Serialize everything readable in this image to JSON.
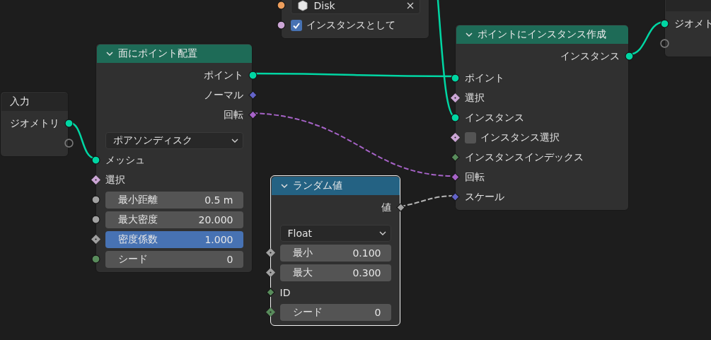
{
  "nodes": [
    {
      "title": "入力",
      "color": "#262626",
      "selected": false,
      "rows": [
        {
          "kind": "output",
          "label": "ジオメトリ",
          "socket": {
            "kind": "circle",
            "color": "#00d6a3"
          }
        },
        {
          "kind": "output",
          "socket": {
            "kind": "hollow"
          }
        }
      ]
    },
    {
      "selected": false,
      "rows": [
        {
          "kind": "object",
          "value": "Disk",
          "socket": {
            "kind": "circle",
            "color": "#ed9e5c"
          }
        },
        {
          "kind": "checkbox",
          "label": "インスタンスとして",
          "checked": true,
          "socket": {
            "kind": "circle",
            "color": "#cca6d6"
          }
        }
      ]
    },
    {
      "title": "面にポイント配置",
      "color": "#1e6b57",
      "expanded": true,
      "selected": false,
      "rows": [
        {
          "kind": "output",
          "label": "ポイント",
          "socket": {
            "kind": "circle",
            "color": "#00d6a3"
          }
        },
        {
          "kind": "output",
          "label": "ノーマル",
          "socket": {
            "kind": "diamond",
            "color": "#6363c7"
          }
        },
        {
          "kind": "output",
          "label": "回転",
          "socket": {
            "kind": "diamond",
            "color": "#a663c7"
          }
        },
        {
          "kind": "dropdown",
          "value": "ポアソンディスク"
        },
        {
          "kind": "input",
          "label": "メッシュ",
          "socket": {
            "kind": "circle",
            "color": "#00d6a3"
          }
        },
        {
          "kind": "input",
          "label": "選択",
          "socket": {
            "kind": "diamond_dot",
            "color": "#cca6d6"
          }
        },
        {
          "kind": "value",
          "label": "最小距離",
          "value": "0.5 m",
          "active": false,
          "socket": {
            "kind": "circle",
            "color": "#a1a1a1"
          }
        },
        {
          "kind": "value",
          "label": "最大密度",
          "value": "20.000",
          "active": false,
          "socket": {
            "kind": "circle",
            "color": "#a1a1a1"
          }
        },
        {
          "kind": "value",
          "label": "密度係数",
          "value": "1.000",
          "active": true,
          "socket": {
            "kind": "diamond_dot",
            "color": "#a1a1a1"
          }
        },
        {
          "kind": "value",
          "label": "シード",
          "value": "0",
          "active": false,
          "socket": {
            "kind": "circle",
            "color": "#598c5c"
          }
        }
      ]
    },
    {
      "title": "ランダム値",
      "color": "#246283",
      "expanded": true,
      "selected": true,
      "rows": [
        {
          "kind": "output",
          "label": "値",
          "socket": {
            "kind": "diamond",
            "color": "#a1a1a1"
          }
        },
        {
          "kind": "dropdown",
          "value": "Float"
        },
        {
          "kind": "value",
          "label": "最小",
          "value": "0.100",
          "active": false,
          "socket": {
            "kind": "diamond_dot",
            "color": "#a1a1a1"
          }
        },
        {
          "kind": "value",
          "label": "最大",
          "value": "0.300",
          "active": false,
          "socket": {
            "kind": "diamond_dot",
            "color": "#a1a1a1"
          }
        },
        {
          "kind": "input",
          "label": "ID",
          "socket": {
            "kind": "diamond",
            "color": "#598c5c"
          }
        },
        {
          "kind": "value",
          "label": "シード",
          "value": "0",
          "active": false,
          "socket": {
            "kind": "diamond_dot",
            "color": "#598c5c"
          }
        }
      ]
    },
    {
      "title": "ポイントにインスタンス作成",
      "color": "#1e6b57",
      "expanded": true,
      "selected": false,
      "rows": [
        {
          "kind": "output",
          "label": "インスタンス",
          "socket": {
            "kind": "circle",
            "color": "#00d6a3"
          }
        },
        {
          "kind": "input",
          "label": "ポイント",
          "socket": {
            "kind": "circle",
            "color": "#00d6a3"
          }
        },
        {
          "kind": "input",
          "label": "選択",
          "socket": {
            "kind": "diamond_dot",
            "color": "#cca6d6"
          }
        },
        {
          "kind": "input",
          "label": "インスタンス",
          "socket": {
            "kind": "circle",
            "color": "#00d6a3"
          }
        },
        {
          "kind": "checkbox",
          "label": "インスタンス選択",
          "checked": false,
          "socket": {
            "kind": "diamond_dot",
            "color": "#cca6d6"
          }
        },
        {
          "kind": "input",
          "label": "インスタンスインデックス",
          "socket": {
            "kind": "diamond",
            "color": "#598c5c"
          }
        },
        {
          "kind": "input",
          "label": "回転",
          "socket": {
            "kind": "diamond",
            "color": "#a663c7"
          }
        },
        {
          "kind": "input",
          "label": "スケール",
          "socket": {
            "kind": "diamond",
            "color": "#6363c7"
          }
        }
      ]
    },
    {
      "color": "#262626",
      "selected": false,
      "rows": [
        {
          "kind": "input",
          "label": "ジオメト",
          "socket": {
            "kind": "circle",
            "color": "#00d6a3"
          }
        },
        {
          "kind": "input",
          "socket": {
            "kind": "hollow"
          }
        }
      ]
    }
  ]
}
